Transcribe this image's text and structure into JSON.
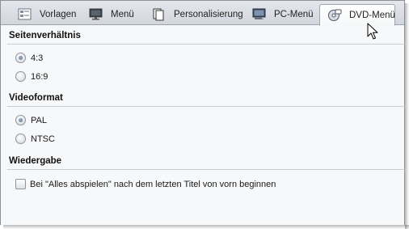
{
  "tabs": [
    {
      "label": "Vorlagen",
      "icon": "templates-icon"
    },
    {
      "label": "Menü",
      "icon": "monitor-icon"
    },
    {
      "label": "Personalisierung",
      "icon": "pages-icon"
    },
    {
      "label": "PC-Menü",
      "icon": "pc-menu-icon"
    },
    {
      "label": "DVD-Menü",
      "icon": "dvd-icon",
      "active": true
    }
  ],
  "sections": {
    "aspect": {
      "title": "Seitenverhältnis",
      "options": [
        {
          "label": "4:3",
          "checked": true
        },
        {
          "label": "16:9",
          "checked": false
        }
      ]
    },
    "video": {
      "title": "Videoformat",
      "options": [
        {
          "label": "PAL",
          "checked": true
        },
        {
          "label": "NTSC",
          "checked": false
        }
      ]
    },
    "playback": {
      "title": "Wiedergabe",
      "checkbox": {
        "label": "Bei \"Alles abspielen\" nach dem letzten Titel von vorn beginnen",
        "checked": false
      }
    }
  },
  "colors": {
    "accent": "#5a6f8a",
    "tabbar": "#d2d6dd",
    "panel": "#f7f8f9"
  }
}
